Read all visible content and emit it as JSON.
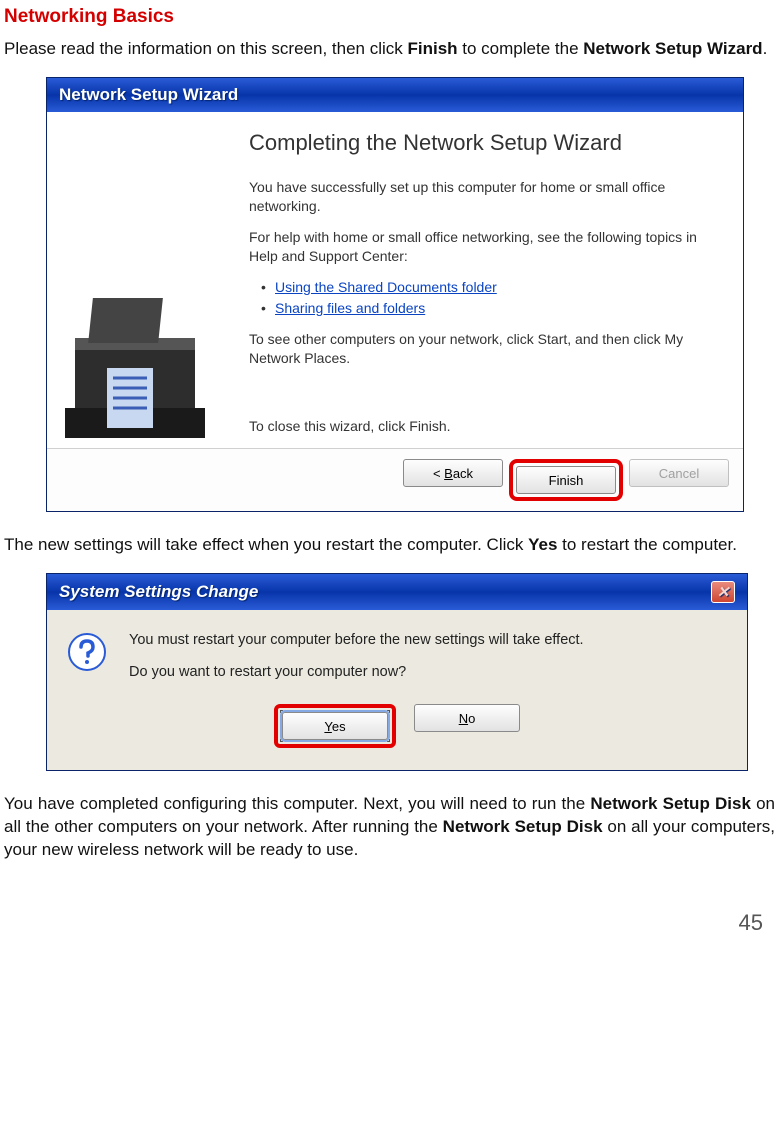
{
  "section_title": "Networking Basics",
  "intro_pre": "Please read the information on this screen, then click ",
  "intro_bold1": "Finish",
  "intro_mid": " to complete the ",
  "intro_bold2": "Network Setup Wizard",
  "intro_post": ".",
  "wizard": {
    "title": "Network Setup Wizard",
    "heading": "Completing the Network Setup Wizard",
    "p1": "You have successfully set up this computer for home or small office networking.",
    "p2": "For help with home or small office networking, see the following topics in Help and Support Center:",
    "link1": "Using the Shared Documents folder",
    "link2": "Sharing files and folders",
    "p3": "To see other computers on your network, click Start, and then click My Network Places.",
    "close_line": "To close this wizard, click Finish.",
    "btn_back_pre": "< ",
    "btn_back_u": "B",
    "btn_back_post": "ack",
    "btn_finish": "Finish",
    "btn_cancel": "Cancel"
  },
  "mid_pre": "The new settings will take effect when you restart the computer. Click ",
  "mid_bold": "Yes",
  "mid_post": " to restart the computer.",
  "msgbox": {
    "title": "System Settings Change",
    "line1": "You must restart your computer before the new settings will take effect.",
    "line2": "Do you want to restart your computer now?",
    "btn_yes_u": "Y",
    "btn_yes_post": "es",
    "btn_no_u": "N",
    "btn_no_post": "o"
  },
  "outro_pre": "You have completed configuring this computer. Next, you will need to run the ",
  "outro_b1": "Network Setup Disk",
  "outro_mid": " on all the other computers on your network. After running the ",
  "outro_b2": "Network Setup Disk",
  "outro_post": " on all your computers, your new wireless network will be ready to use.",
  "page_number": "45"
}
